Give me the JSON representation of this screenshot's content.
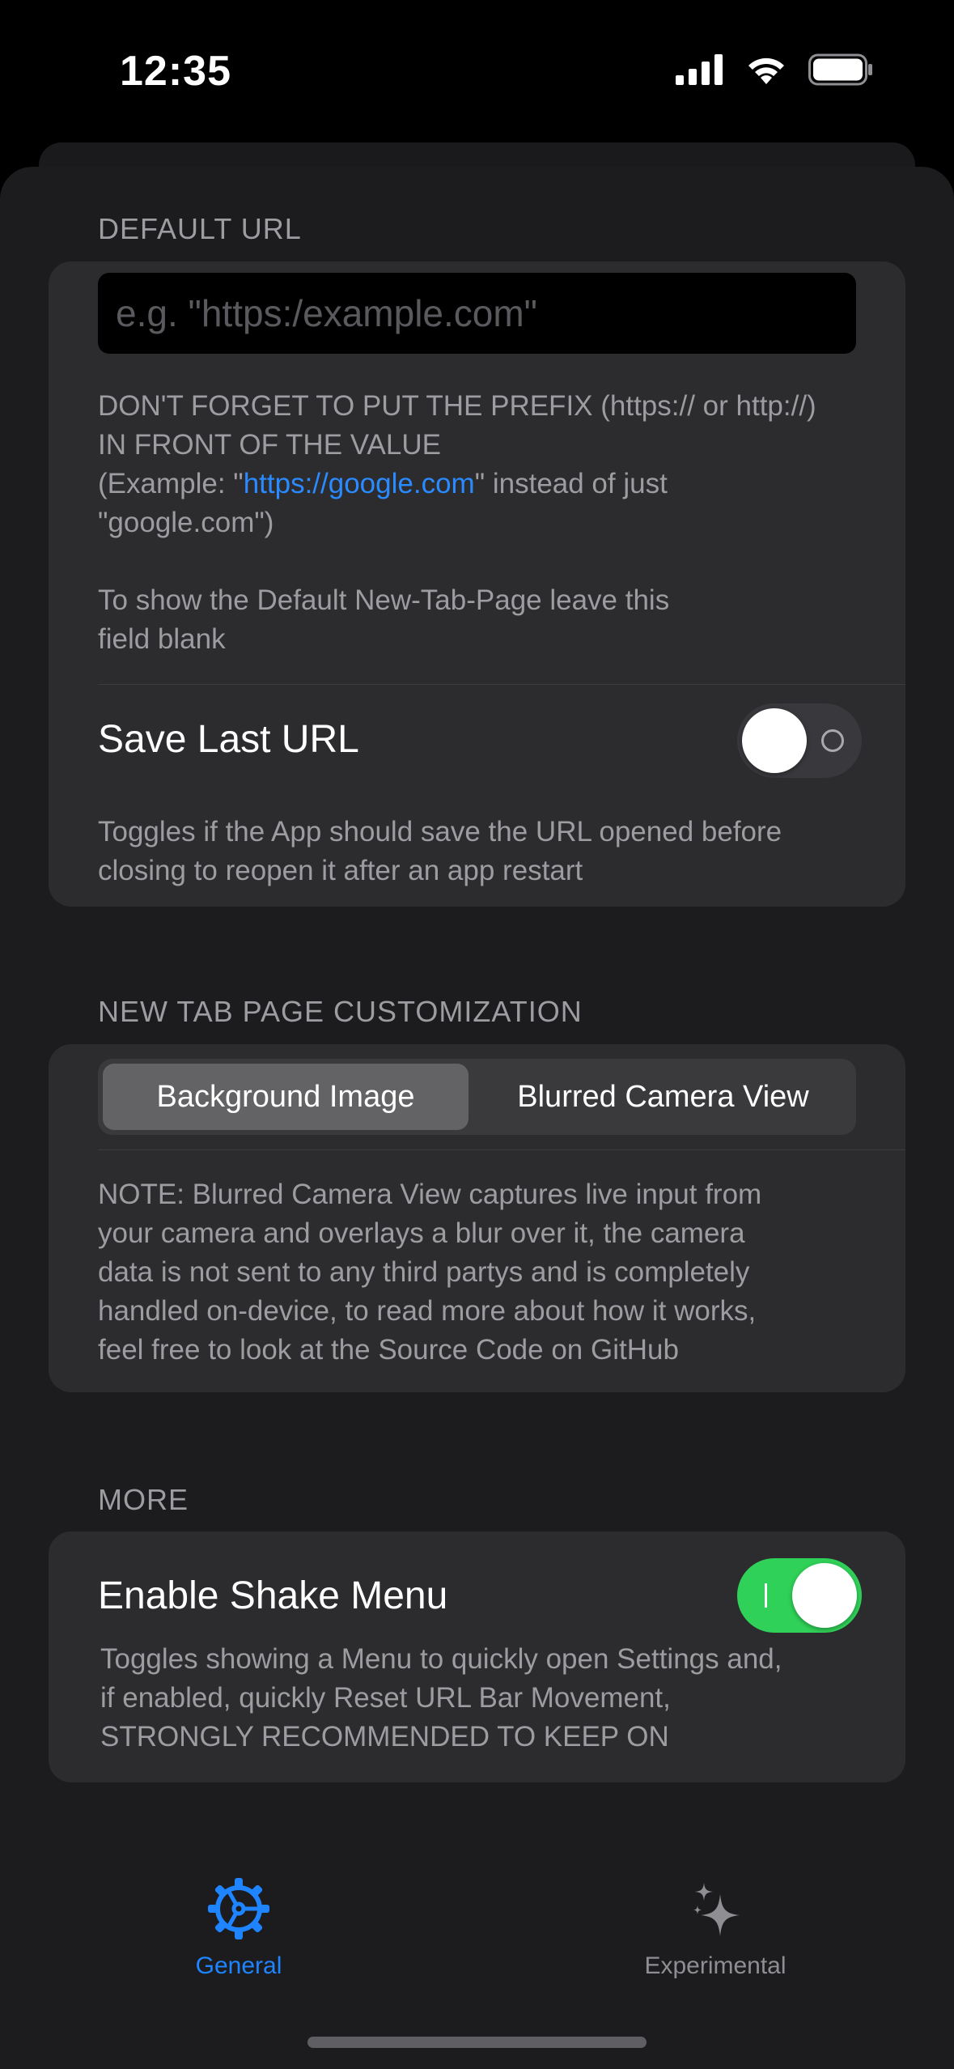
{
  "status_bar": {
    "time": "12:35"
  },
  "sections": {
    "default_url": {
      "header": "DEFAULT URL",
      "input_placeholder": "e.g. \"https:/example.com\"",
      "input_value": "",
      "note_line1": "DON'T FORGET TO PUT THE PREFIX (https:// or http://)",
      "note_line2": "IN FRONT OF THE VALUE",
      "note_line3_prefix": "(Example: \"",
      "note_line3_link": "https://google.com",
      "note_line3_suffix": "\" instead of just",
      "note_line4": "\"google.com\")",
      "blank_note_line1": "To show the Default New-Tab-Page leave this",
      "blank_note_line2": "field blank",
      "save_last_url_label": "Save Last URL",
      "save_last_url_enabled": false,
      "save_last_url_note_line1": "Toggles if the App should save the URL opened before",
      "save_last_url_note_line2": "closing to reopen it after an app restart"
    },
    "new_tab": {
      "header": "NEW TAB PAGE CUSTOMIZATION",
      "segments": [
        "Background Image",
        "Blurred Camera View"
      ],
      "selected_segment": "Background Image",
      "note_lines": [
        "NOTE: Blurred Camera View captures live input from",
        "your camera and overlays a blur over it, the camera",
        "data is not sent to any third partys and is completely",
        "handled on-device, to read more about how it works,",
        "feel free to look at the Source Code on GitHub"
      ]
    },
    "more": {
      "header": "MORE",
      "shake_menu_label": "Enable Shake Menu",
      "shake_menu_enabled": true,
      "note_lines": [
        "Toggles showing a Menu to quickly open Settings and,",
        "if enabled, quickly Reset URL Bar Movement,",
        "STRONGLY RECOMMENDED TO KEEP ON"
      ]
    }
  },
  "tab_bar": {
    "tabs": [
      {
        "label": "General",
        "icon": "gear-icon",
        "active": true
      },
      {
        "label": "Experimental",
        "icon": "sparkles-icon",
        "active": false
      }
    ]
  },
  "colors": {
    "accent": "#1f84ff",
    "toggle_on": "#30d158",
    "card_bg": "#2c2c2e",
    "sheet_bg": "#1c1c1e",
    "secondary_text": "#9c9ca1"
  }
}
